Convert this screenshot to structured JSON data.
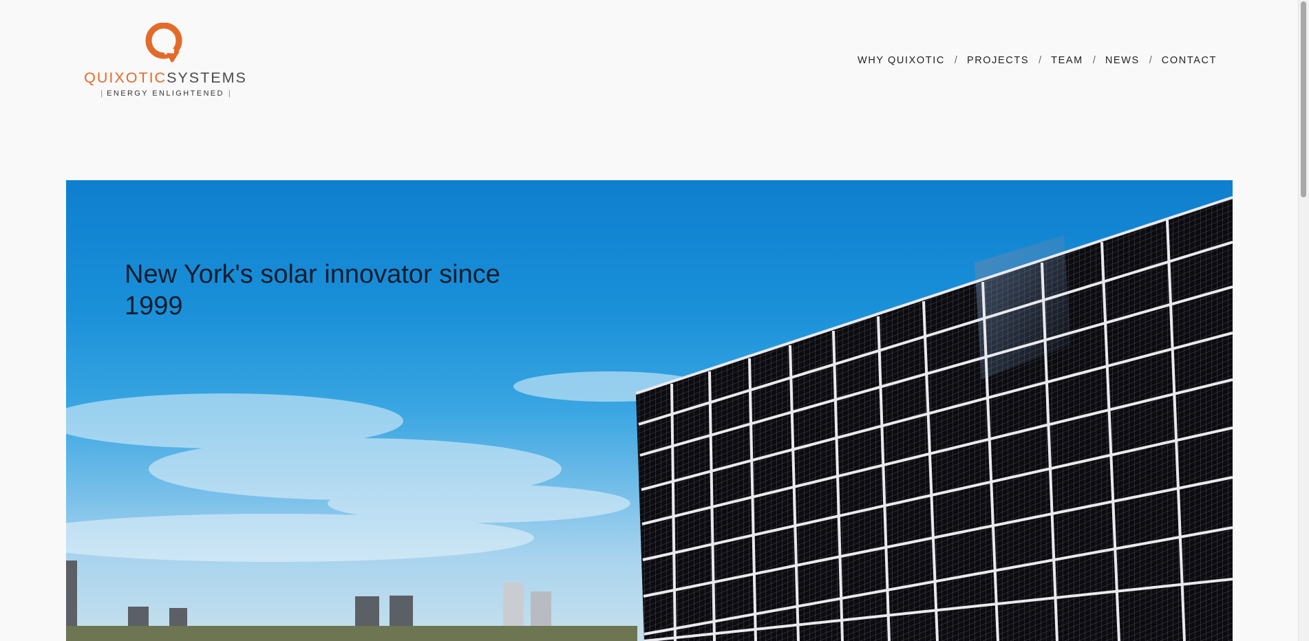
{
  "logo": {
    "word_part1": "QUIXOTIC",
    "word_part2": "SYSTEMS",
    "tagline": "ENERGY ENLIGHTENED",
    "mark_icon": "quixotic-q-arrow-icon",
    "accent_color": "#e36b2a"
  },
  "nav": {
    "items": [
      {
        "label": "WHY QUIXOTIC"
      },
      {
        "label": "PROJECTS"
      },
      {
        "label": "TEAM"
      },
      {
        "label": "NEWS"
      },
      {
        "label": "CONTACT"
      }
    ],
    "separator": "/"
  },
  "hero": {
    "title": "New York's solar innovator since 1999"
  }
}
